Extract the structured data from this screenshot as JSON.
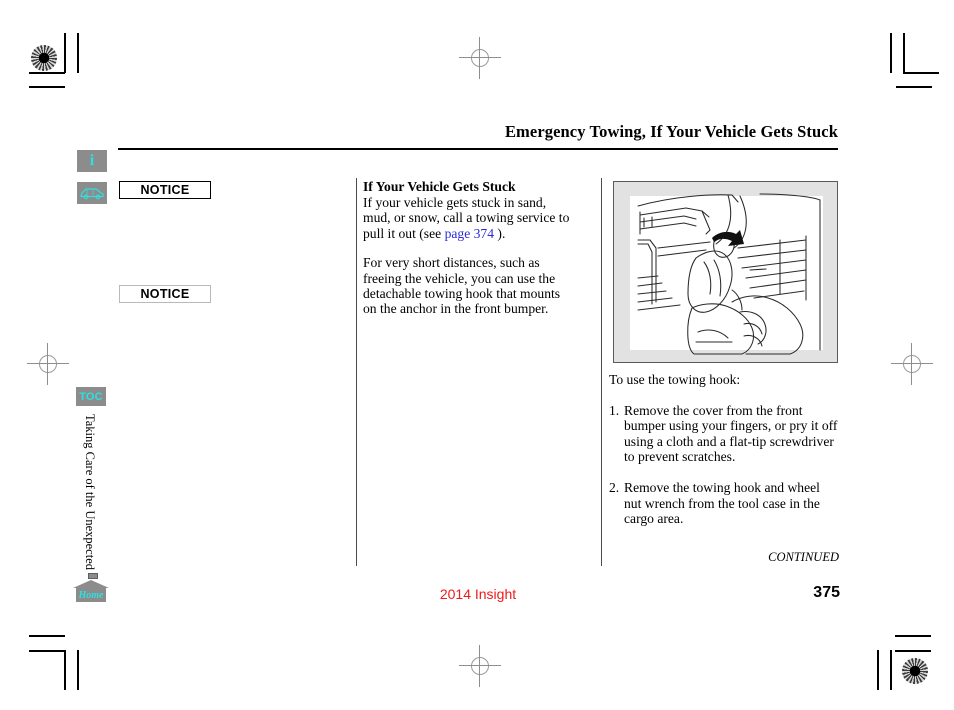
{
  "header": {
    "title": "Emergency Towing, If Your Vehicle Gets Stuck"
  },
  "rail": {
    "info_icon_glyph": "i",
    "info_icon_name": "information-icon",
    "car_icon_name": "vehicle-icon",
    "toc_label": "TOC",
    "chapter_label": "Taking Care of the Unexpected",
    "home_label": "Home"
  },
  "notices": [
    {
      "label": "NOTICE",
      "style": "dark"
    },
    {
      "label": "NOTICE",
      "style": "light"
    }
  ],
  "middle": {
    "heading": "If Your Vehicle Gets Stuck",
    "para1_before": "If your vehicle gets stuck in sand, mud, or snow, call a towing service to pull it out (see ",
    "para1_link": "page 374",
    "para1_after": " ).",
    "para2": "For very short distances, such as freeing the vehicle, you can use the detachable towing hook that mounts on the anchor in the front bumper."
  },
  "right": {
    "illustration_name": "bumper-cover-removal-illustration",
    "intro": "To use the towing hook:",
    "steps": [
      {
        "num": "1.",
        "text": "Remove the cover from the front bumper using your fingers, or pry it off using a cloth and a flat-tip screwdriver to prevent scratches."
      },
      {
        "num": "2.",
        "text": "Remove the towing hook and wheel nut wrench from the tool case in the cargo area."
      }
    ],
    "continued": "CONTINUED"
  },
  "footer": {
    "model": "2014 Insight",
    "page_number": "375"
  },
  "colors": {
    "accent_cyan": "#2ee0e0",
    "link_blue": "#2b2bd4",
    "footer_red": "#ee1b1b",
    "icon_gray": "#8c8c8c",
    "illustration_bg": "#e2e2e2"
  }
}
